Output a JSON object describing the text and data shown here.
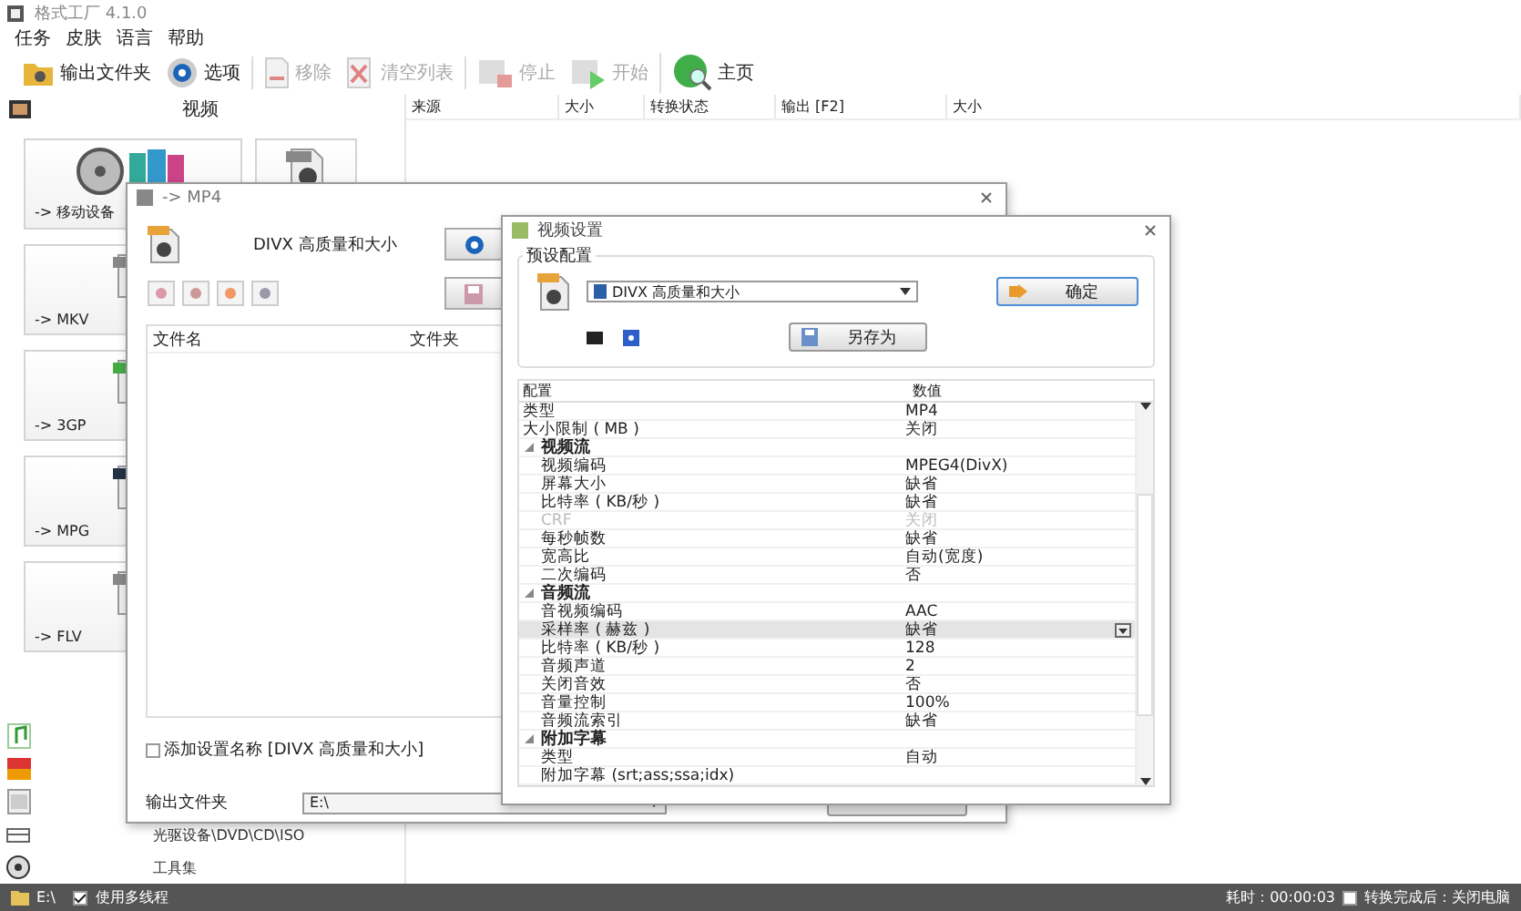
{
  "app": {
    "title": "格式工厂 4.1.0"
  },
  "menu": [
    "任务",
    "皮肤",
    "语言",
    "帮助"
  ],
  "toolbar_groups": [
    {
      "buttons": [
        {
          "label": "输出文件夹",
          "kind": "folder",
          "disabled": false
        },
        {
          "label": "选项",
          "kind": "options",
          "disabled": false
        }
      ]
    },
    {
      "buttons": [
        {
          "label": "移除",
          "kind": "remove",
          "disabled": true
        },
        {
          "label": "清空列表",
          "kind": "clear",
          "disabled": true
        }
      ]
    },
    {
      "buttons": [
        {
          "label": "停止",
          "kind": "stop",
          "disabled": true
        },
        {
          "label": "开始",
          "kind": "start",
          "disabled": true
        }
      ]
    },
    {
      "buttons": [
        {
          "label": "主页",
          "kind": "home",
          "disabled": false
        }
      ]
    }
  ],
  "file_table": {
    "columns": [
      "来源",
      "大小",
      "转换状态",
      "输出 [F2]",
      "大小"
    ]
  },
  "sidebar": {
    "category": "视频",
    "tile_rows": [
      {
        "tiles": [
          {
            "label": "-> 移动设备",
            "kind": "mobile"
          },
          {
            "kind": "mp4"
          }
        ]
      },
      {
        "tiles": [
          {
            "label": "-> MKV",
            "kind": "mkv"
          }
        ]
      },
      {
        "tiles": [
          {
            "label": "-> 3GP",
            "kind": "threegp"
          }
        ]
      },
      {
        "tiles": [
          {
            "label": "-> MPG",
            "kind": "mpg"
          }
        ]
      },
      {
        "tiles": [
          {
            "label": "-> FLV",
            "kind": "flv"
          }
        ]
      }
    ],
    "categories": [
      {
        "kind": "audio"
      },
      {
        "kind": "image"
      },
      {
        "kind": "document"
      },
      {
        "kind": "disc",
        "label": "光驱设备\\DVD\\CD\\ISO"
      },
      {
        "kind": "tools",
        "label": "工具集"
      }
    ]
  },
  "mp4_dialog": {
    "title": "-> MP4",
    "preset": "DIVX 高质量和大小",
    "columns": [
      "文件名",
      "文件夹"
    ],
    "add_name": {
      "label": "添加设置名称 [DIVX 高质量和大小]",
      "checked": false
    },
    "output_label": "输出文件夹",
    "output_value": "E:\\"
  },
  "video_settings": {
    "title": "视频设置",
    "group_label": "预设配置",
    "preset": "DIVX 高质量和大小",
    "ok": "确定",
    "save_as": "另存为",
    "columns": [
      "配置",
      "数值"
    ],
    "rows": [
      {
        "name": "类型",
        "value": "MP4",
        "disabled": false,
        "selected": false
      },
      {
        "name": "大小限制 ( MB )",
        "value": "关闭",
        "disabled": false,
        "selected": false
      },
      {
        "name": "视频流",
        "kind": "group",
        "expanded": true,
        "disabled": false,
        "selected": false,
        "children": [
          {
            "name": "视频编码",
            "value": "MPEG4(DivX)",
            "disabled": false,
            "selected": false
          },
          {
            "name": "屏幕大小",
            "value": "缺省",
            "disabled": false,
            "selected": false
          },
          {
            "name": "比特率 ( KB/秒 )",
            "value": "缺省",
            "disabled": false,
            "selected": false
          },
          {
            "name": "CRF",
            "value": "关闭",
            "disabled": true,
            "selected": false
          },
          {
            "name": "每秒帧数",
            "value": "缺省",
            "disabled": false,
            "selected": false
          },
          {
            "name": "宽高比",
            "value": "自动(宽度)",
            "disabled": false,
            "selected": false
          },
          {
            "name": "二次编码",
            "value": "否",
            "disabled": false,
            "selected": false
          }
        ]
      },
      {
        "name": "音频流",
        "kind": "group",
        "expanded": true,
        "disabled": false,
        "selected": false,
        "children": [
          {
            "name": "音视频编码",
            "value": "AAC",
            "disabled": false,
            "selected": false
          },
          {
            "name": "采样率 ( 赫兹 )",
            "value": "缺省",
            "disabled": false,
            "selected": true
          },
          {
            "name": "比特率 ( KB/秒 )",
            "value": "128",
            "disabled": false,
            "selected": false
          },
          {
            "name": "音频声道",
            "value": "2",
            "disabled": false,
            "selected": false
          },
          {
            "name": "关闭音效",
            "value": "否",
            "disabled": false,
            "selected": false
          },
          {
            "name": "音量控制",
            "value": "100%",
            "disabled": false,
            "selected": false
          },
          {
            "name": "音频流索引",
            "value": "缺省",
            "disabled": false,
            "selected": false
          }
        ]
      },
      {
        "name": "附加字幕",
        "kind": "group",
        "expanded": true,
        "disabled": false,
        "selected": false,
        "children": [
          {
            "name": "类型",
            "value": "自动",
            "disabled": false,
            "selected": false
          },
          {
            "name": "附加字幕 (srt;ass;ssa;idx)",
            "disabled": false,
            "selected": false
          }
        ]
      }
    ]
  },
  "status_bar": {
    "folder": "E:\\",
    "multithread": {
      "label": "使用多线程",
      "checked": true
    },
    "elapsed": "耗时：00:00:03",
    "shutdown": {
      "label": "转换完成后：关闭电脑",
      "checked": false
    }
  }
}
